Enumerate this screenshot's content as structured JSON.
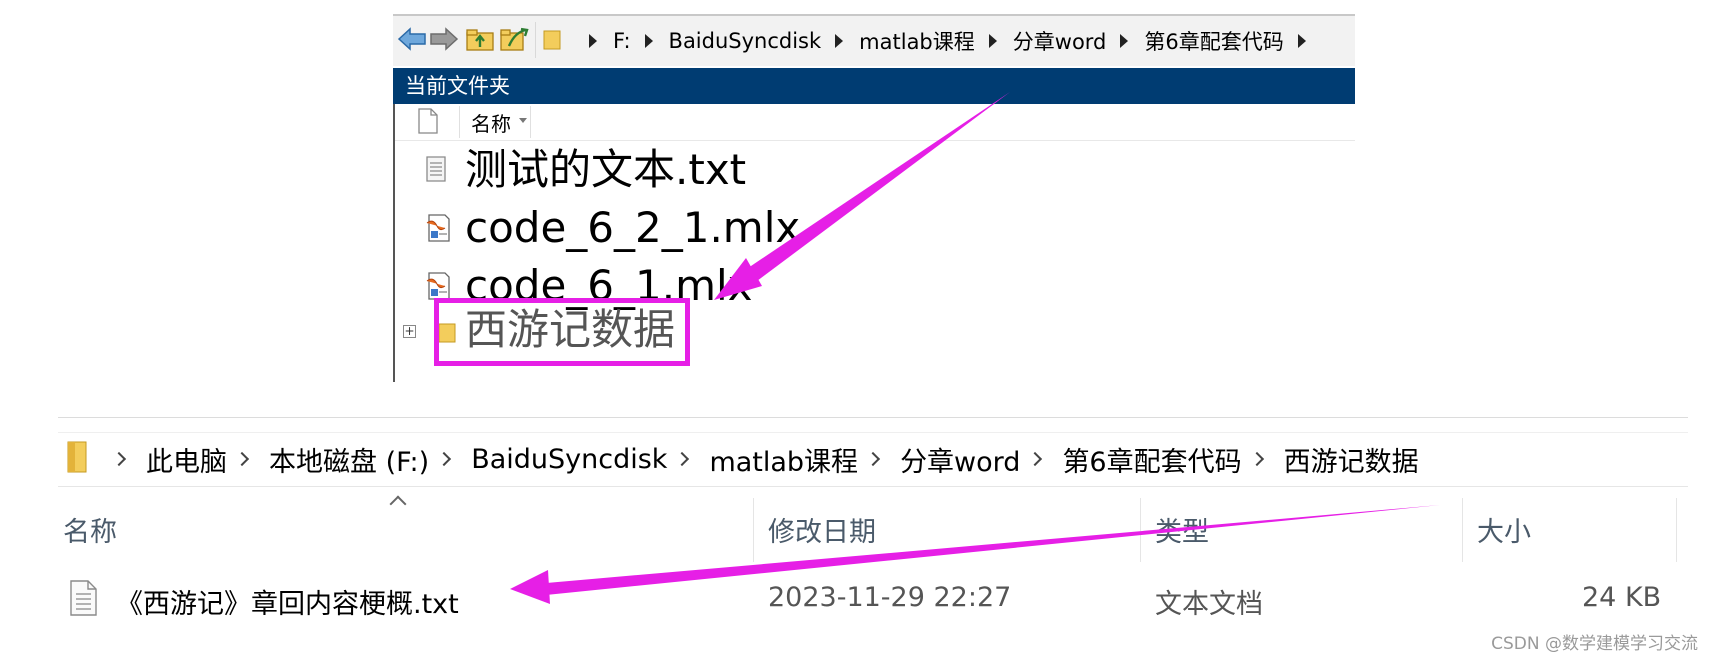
{
  "matlab_panel": {
    "toolbar_icons": [
      "back-arrow-icon",
      "forward-arrow-icon",
      "up-folder-icon",
      "browse-folder-icon"
    ],
    "path": [
      "F:",
      "BaiduSyncdisk",
      "matlab课程",
      "分章word",
      "第6章配套代码"
    ],
    "header": "当前文件夹",
    "column_name": "名称",
    "files": [
      {
        "name": "测试的文本.txt",
        "icon": "text-file-icon"
      },
      {
        "name": "code_6_2_1.mlx",
        "icon": "live-script-icon"
      },
      {
        "name": "code_6_1.mlx",
        "icon": "live-script-icon"
      }
    ],
    "folder": {
      "name": "西游记数据",
      "expander": "+",
      "icon": "folder-icon"
    },
    "highlight_color": "#e61fe6"
  },
  "explorer": {
    "breadcrumb": [
      "此电脑",
      "本地磁盘 (F:)",
      "BaiduSyncdisk",
      "matlab课程",
      "分章word",
      "第6章配套代码",
      "西游记数据"
    ],
    "columns": {
      "name": "名称",
      "modified": "修改日期",
      "type": "类型",
      "size": "大小"
    },
    "row": {
      "name": "《西游记》章回内容梗概.txt",
      "modified": "2023-11-29 22:27",
      "type": "文本文档",
      "size": "24 KB"
    }
  },
  "annotation_color": "#e61fe6",
  "watermark": "CSDN @数学建模学习交流"
}
